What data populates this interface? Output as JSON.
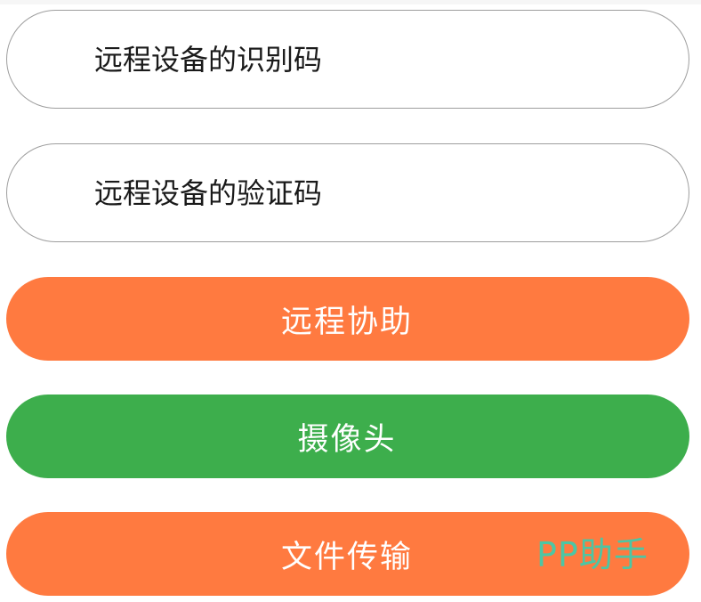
{
  "form": {
    "device_id_field": {
      "placeholder": "远程设备的识别码",
      "value": ""
    },
    "verify_code_field": {
      "placeholder": "远程设备的验证码",
      "value": ""
    }
  },
  "actions": {
    "remote_assist_label": "远程协助",
    "camera_label": "摄像头",
    "file_transfer_label": "文件传输"
  },
  "watermark": {
    "text": "PP助手"
  },
  "colors": {
    "orange": "#ff7a40",
    "green": "#3dae4c",
    "field_border": "#9e9e9e",
    "watermark": "#4cc6a4"
  }
}
